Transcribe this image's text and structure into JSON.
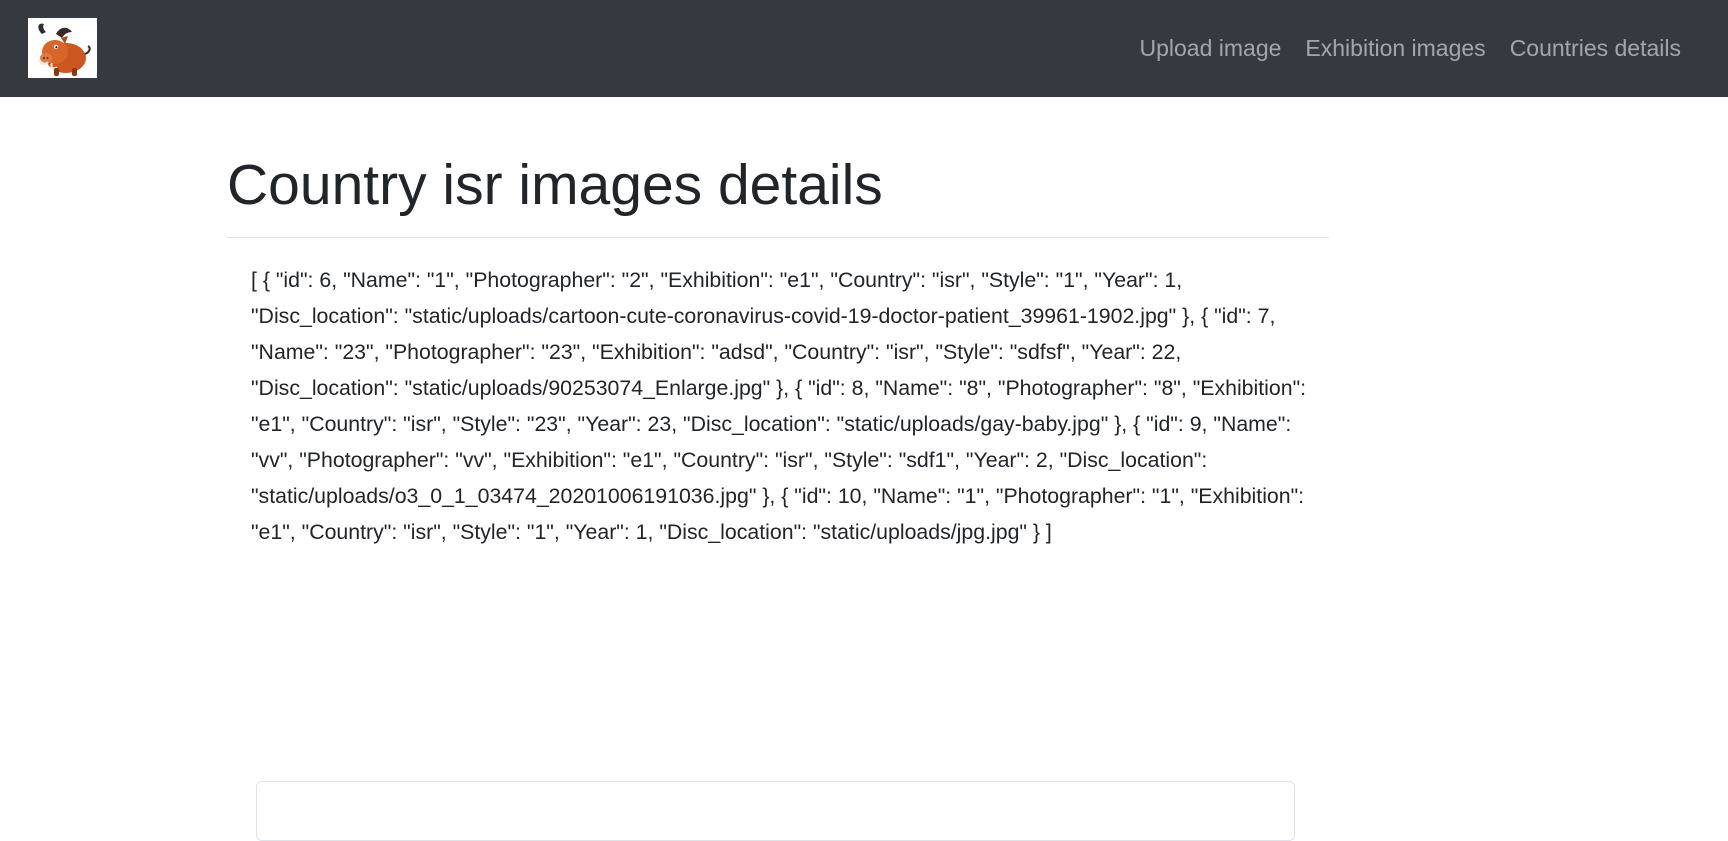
{
  "navbar": {
    "logo_alt": "pumbaa-logo",
    "links": [
      {
        "label": "Upload image"
      },
      {
        "label": "Exhibition images"
      },
      {
        "label": "Countries details"
      }
    ]
  },
  "main": {
    "title": "Country isr images details",
    "json_output": "[ { \"id\": 6, \"Name\": \"1\", \"Photographer\": \"2\", \"Exhibition\": \"e1\", \"Country\": \"isr\", \"Style\": \"1\", \"Year\": 1, \"Disc_location\": \"static/uploads/cartoon-cute-coronavirus-covid-19-doctor-patient_39961-1902.jpg\" }, { \"id\": 7, \"Name\": \"23\", \"Photographer\": \"23\", \"Exhibition\": \"adsd\", \"Country\": \"isr\", \"Style\": \"sdfsf\", \"Year\": 22, \"Disc_location\": \"static/uploads/90253074_Enlarge.jpg\" }, { \"id\": 8, \"Name\": \"8\", \"Photographer\": \"8\", \"Exhibition\": \"e1\", \"Country\": \"isr\", \"Style\": \"23\", \"Year\": 23, \"Disc_location\": \"static/uploads/gay-baby.jpg\" }, { \"id\": 9, \"Name\": \"vv\", \"Photographer\": \"vv\", \"Exhibition\": \"e1\", \"Country\": \"isr\", \"Style\": \"sdf1\", \"Year\": 2, \"Disc_location\": \"static/uploads/o3_0_1_03474_20201006191036.jpg\" }, { \"id\": 10, \"Name\": \"1\", \"Photographer\": \"1\", \"Exhibition\": \"e1\", \"Country\": \"isr\", \"Style\": \"1\", \"Year\": 1, \"Disc_location\": \"static/uploads/jpg.jpg\" } ]"
  },
  "colors": {
    "navbar_bg": "#343a40",
    "nav_link": "rgba(255,255,255,0.55)",
    "text": "#212529"
  }
}
